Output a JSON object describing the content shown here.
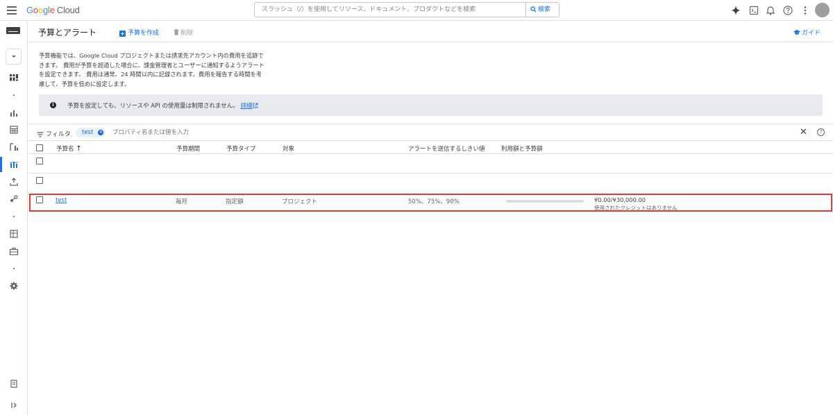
{
  "topbar": {
    "logo_google": [
      "G",
      "o",
      "o",
      "g",
      "l",
      "e"
    ],
    "logo_cloud": "Cloud",
    "search_placeholder": "スラッシュ（/）を使用してリソース、ドキュメント、プロダクトなどを検索",
    "search_button": "検索",
    "icons": [
      "gemini-icon",
      "cloud-shell-icon",
      "notifications-icon",
      "help-icon",
      "more-vert-icon"
    ]
  },
  "leftnav": {
    "icons": [
      "dashboard-icon",
      "reports-icon",
      "calculator-icon",
      "cost-breakdown-icon",
      "budgets-icon",
      "export-icon",
      "commitments-icon",
      "table-icon",
      "briefcase-icon",
      "settings-icon",
      "release-notes-icon",
      "expand-icon"
    ]
  },
  "header": {
    "title": "予算とアラート",
    "create_label": "予算を作成",
    "delete_label": "削除",
    "guide_label": "ガイド"
  },
  "description": "予算機能では、Google Cloud プロジェクトまたは請求先アカウント内の費用を追跡できます。 費用が予算を超過した場合に、課金管理者とユーザーに通知するようアラートを設定できます。 費用は通常、24 時間以内に記録されます。費用を報告する時間を考慮して、予算を低めに設定します。",
  "banner": {
    "text": "予算を設定しても、リソースや API の使用量は制限されません。",
    "link": "詳細"
  },
  "filter": {
    "label": "フィルタ",
    "chip": "test",
    "placeholder": "プロパティ名または値を入力"
  },
  "table": {
    "columns": [
      "予算名",
      "予算期間",
      "予算タイプ",
      "対象",
      "アラートを送信するしきい値",
      "利用額と予算額"
    ],
    "rows": [
      {
        "name": "test",
        "period": "毎月",
        "type": "指定額",
        "scope": "プロジェクト",
        "thresholds": "50%、75%、90%",
        "usage_fraction": 0.0,
        "amount": "¥0.00/¥30,000.00",
        "credit_note": "使用されたクレジットはありません"
      }
    ]
  },
  "colors": {
    "accent": "#1a73e8",
    "highlight": "#e53935"
  }
}
